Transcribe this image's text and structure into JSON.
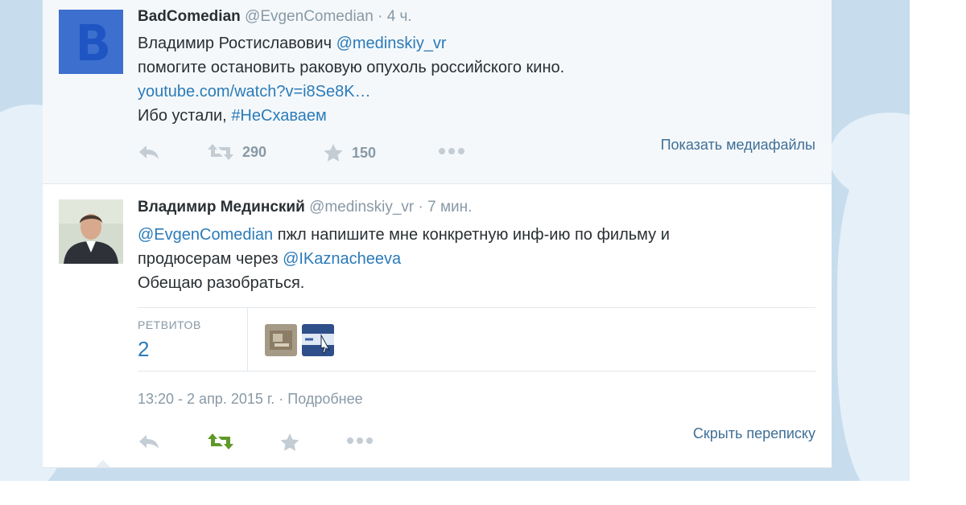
{
  "tweet1": {
    "name": "BadComedian",
    "handle": "@EvgenComedian",
    "time": "4 ч.",
    "text_line1_prefix": "Владимир Ростиславович ",
    "mention": "@medinskiy_vr",
    "text_line2": "помогите остановить раковую опухоль российского кино.",
    "link": "youtube.com/watch?v=i8Se8K…",
    "text_line4_prefix": "Ибо устали, ",
    "hashtag": "#НеСхаваем",
    "retweets": "290",
    "favorites": "150",
    "media_link": "Показать медиафайлы"
  },
  "tweet2": {
    "name": "Владимир Мединский",
    "handle": "@medinskiy_vr",
    "time": "7 мин.",
    "mention1": "@EvgenComedian",
    "text_line1_suffix": " пжл напишите мне конкретную инф-ию по фильму и",
    "text_line2_prefix": "продюсерам через ",
    "mention2": "@IKaznacheeva",
    "text_line3": "Обещаю разобраться.",
    "stats_label": "РЕТВИТОВ",
    "stats_value": "2",
    "timestamp": "13:20 - 2 апр. 2015 г.",
    "details_link": "Подробнее",
    "hide_link": "Скрыть переписку"
  },
  "colors": {
    "link": "#2b7bb9",
    "text": "#292f33",
    "muted": "#8899a6",
    "retweeted_green": "#609928",
    "background_sky": "#c7ddee"
  },
  "icons": {
    "reply": "reply-icon",
    "retweet": "retweet-icon",
    "favorite": "star-icon",
    "more": "more-icon"
  }
}
